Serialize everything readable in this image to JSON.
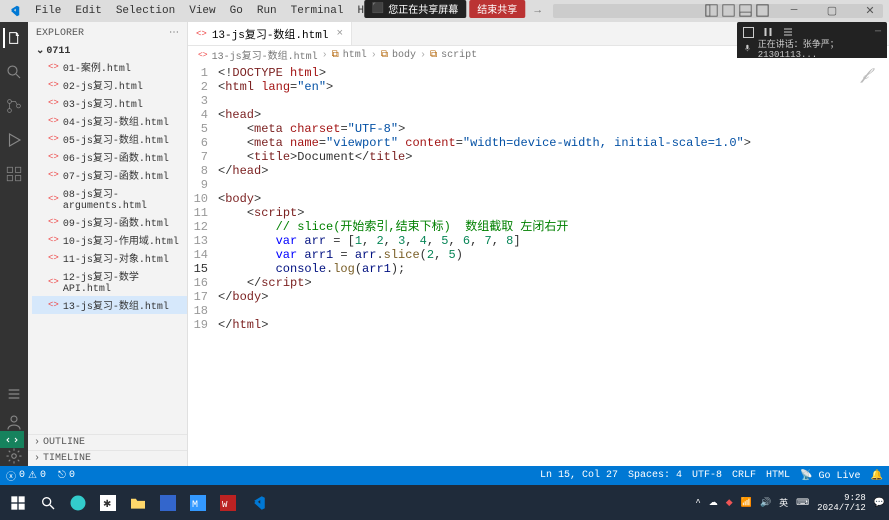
{
  "menu": {
    "items": [
      "File",
      "Edit",
      "Selection",
      "View",
      "Go",
      "Run",
      "Terminal",
      "Help"
    ],
    "share_text": "您正在共享屏幕",
    "share_end": "结束共享"
  },
  "explorer": {
    "title": "EXPLORER",
    "folder": "0711",
    "files": [
      "01-案例.html",
      "02-js复习.html",
      "03-js复习.html",
      "04-js复习-数组.html",
      "05-js复习-数组.html",
      "06-js复习-函数.html",
      "07-js复习-函数.html",
      "08-js复习-arguments.html",
      "09-js复习-函数.html",
      "10-js复习-作用域.html",
      "11-js复习-对象.html",
      "12-js复习-数学API.html",
      "13-js复习-数组.html"
    ],
    "active_index": 12,
    "outline": "OUTLINE",
    "timeline": "TIMELINE"
  },
  "tab": {
    "name": "13-js复习-数组.html"
  },
  "crumbs": [
    "13-js复习-数组.html",
    "html",
    "body",
    "script"
  ],
  "code": {
    "lines": [
      {
        "n": 1,
        "html": "<span class='pn'>&lt;!</span><span class='tag'>DOCTYPE</span> <span class='attr'>html</span><span class='pn'>&gt;</span>"
      },
      {
        "n": 2,
        "html": "<span class='pn'>&lt;</span><span class='tag'>html</span> <span class='attr'>lang</span>=<span class='str'>\"en\"</span><span class='pn'>&gt;</span>"
      },
      {
        "n": 3,
        "html": ""
      },
      {
        "n": 4,
        "html": "<span class='pn'>&lt;</span><span class='tag'>head</span><span class='pn'>&gt;</span>"
      },
      {
        "n": 5,
        "html": "    <span class='pn'>&lt;</span><span class='tag'>meta</span> <span class='attr'>charset</span>=<span class='str'>\"UTF-8\"</span><span class='pn'>&gt;</span>"
      },
      {
        "n": 6,
        "html": "    <span class='pn'>&lt;</span><span class='tag'>meta</span> <span class='attr'>name</span>=<span class='str'>\"viewport\"</span> <span class='attr'>content</span>=<span class='str'>\"width=device-width, initial-scale=1.0\"</span><span class='pn'>&gt;</span>"
      },
      {
        "n": 7,
        "html": "    <span class='pn'>&lt;</span><span class='tag'>title</span><span class='pn'>&gt;</span>Document<span class='pn'>&lt;/</span><span class='tag'>title</span><span class='pn'>&gt;</span>"
      },
      {
        "n": 8,
        "html": "<span class='pn'>&lt;/</span><span class='tag'>head</span><span class='pn'>&gt;</span>"
      },
      {
        "n": 9,
        "html": ""
      },
      {
        "n": 10,
        "html": "<span class='pn'>&lt;</span><span class='tag'>body</span><span class='pn'>&gt;</span>"
      },
      {
        "n": 11,
        "html": "    <span class='pn'>&lt;</span><span class='tag'>script</span><span class='pn'>&gt;</span>"
      },
      {
        "n": 12,
        "html": "        <span class='cm'>// slice(开始索引,结束下标)  数组截取 左闭右开</span>"
      },
      {
        "n": 13,
        "html": "        <span class='kw'>var</span> <span class='var'>arr</span> = [<span class='num'>1</span>, <span class='num'>2</span>, <span class='num'>3</span>, <span class='num'>4</span>, <span class='num'>5</span>, <span class='num'>6</span>, <span class='num'>7</span>, <span class='num'>8</span>]"
      },
      {
        "n": 14,
        "html": "        <span class='kw'>var</span> <span class='var'>arr1</span> = <span class='var'>arr</span>.<span class='fn'>slice</span>(<span class='num'>2</span>, <span class='num'>5</span>)"
      },
      {
        "n": 15,
        "html": "        <span class='var'>console</span>.<span class='fn'>log</span>(<span class='var'>arr1</span>);",
        "cur": true
      },
      {
        "n": 16,
        "html": "    <span class='pn'>&lt;/</span><span class='tag'>script</span><span class='pn'>&gt;</span>"
      },
      {
        "n": 17,
        "html": "<span class='pn'>&lt;/</span><span class='tag'>body</span><span class='pn'>&gt;</span>"
      },
      {
        "n": 18,
        "html": ""
      },
      {
        "n": 19,
        "html": "<span class='pn'>&lt;/</span><span class='tag'>html</span><span class='pn'>&gt;</span>"
      }
    ]
  },
  "overlay": {
    "talking": "正在讲话：张争严；21301113..."
  },
  "status": {
    "errors": "0",
    "warnings": "0",
    "port": "0",
    "pos": "Ln 15, Col 27",
    "spaces": "Spaces: 4",
    "enc": "UTF-8",
    "eol": "CRLF",
    "lang": "HTML",
    "live": "Go Live"
  },
  "tray": {
    "ime": "英",
    "time": "9:28",
    "date": "2024/7/12"
  }
}
